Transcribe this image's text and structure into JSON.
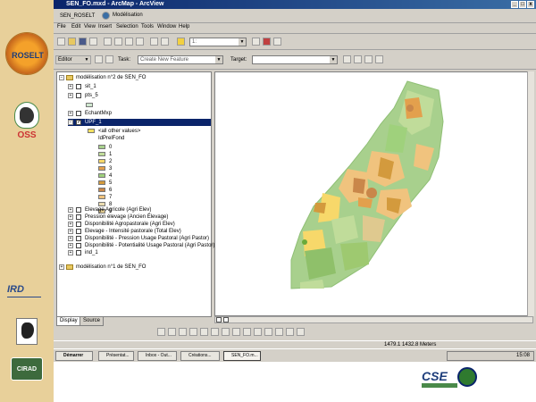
{
  "sidebar": {
    "logos": [
      {
        "name": "roselt-logo",
        "text": "ROSELT"
      },
      {
        "name": "oss-logo",
        "text": "OSS"
      },
      {
        "name": "ird-logo",
        "text": "IRD"
      },
      {
        "name": "africa-logo",
        "text": ""
      },
      {
        "name": "cirad-logo",
        "text": "CIRAD"
      }
    ]
  },
  "window": {
    "title": "SEN_FO.mxd - ArcMap - ArcView",
    "menu_project_label": "SEN_ROSELT",
    "menu_mode_label": "Modélisation",
    "menus": [
      "File",
      "Edit",
      "View",
      "Insert",
      "Selection",
      "Tools",
      "Window",
      "Help"
    ],
    "scale_value": "1:",
    "editor_label": "Editor",
    "task_label": "Task:",
    "task_value": "Create New Feature",
    "target_label": "Target:"
  },
  "toc": {
    "root_label": "modélisation n°2 de SEN_FO",
    "items": [
      {
        "label": "sit_1",
        "checked": false,
        "expanded": true
      },
      {
        "label": "pts_5",
        "checked": false,
        "expanded": true
      },
      {
        "label": "EchantMxp",
        "checked": false,
        "expanded": true
      },
      {
        "label": "UPF_1",
        "checked": true,
        "expanded": true,
        "selected": true
      }
    ],
    "legend_header_1": "<all other values>",
    "legend_header_2": "IdPrelFond",
    "legend_values": [
      "0",
      "1",
      "2",
      "3",
      "4",
      "5",
      "6",
      "7",
      "8",
      "9"
    ],
    "legend_colors": [
      "#a8d08d",
      "#c0dc9a",
      "#f7d86a",
      "#e3a04d",
      "#9fd17c",
      "#d39a3d",
      "#c9874a",
      "#f0c37e",
      "#eadcb0",
      "#dfc98f"
    ],
    "layers": [
      "Elevage Agricole (Agri Elev)",
      "Pression élevage (Ancien Élevage)",
      "Disponibilité Agropastorale (Agri Elev)",
      "Elevage - Intensité pastorale (Total Elev)",
      "Disponibilité - Pression Usage Pastoral (Agri Pastor)",
      "Disponibilité - Potentialité Usage Pastoral (Agri Pastor)",
      "ind_1"
    ],
    "second_root_label": "modélisation n°1 de SEN_FO"
  },
  "tabs": {
    "display": "Display",
    "source": "Source"
  },
  "status": {
    "coords": "1479.1  1432.8 Meters"
  },
  "taskbar": {
    "items": [
      "Démarrer",
      "Présentat...",
      "Inbox - Out...",
      "Créations...",
      "SEN_FO.m..."
    ],
    "clock": "15:08"
  },
  "map": {
    "background_color": "#a8d08d",
    "accent_colors": [
      "#e3a04d",
      "#f7d86a",
      "#9ec970",
      "#c9874a",
      "#8fc06a"
    ]
  },
  "bottom": {
    "logo_text": "CSE"
  },
  "colors": {
    "title_bar": "#0a246a",
    "selection": "#0a246a",
    "sidebar": "#e8d09a"
  }
}
